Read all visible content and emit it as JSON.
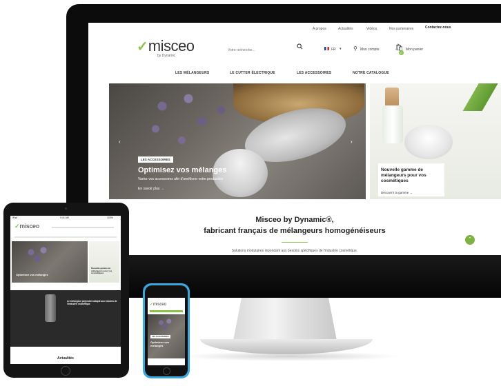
{
  "desktop": {
    "topbar": {
      "links": [
        "A propos",
        "Actualités",
        "Vidéos",
        "Nos partenaires"
      ],
      "contact": "Contactez-nous"
    },
    "header": {
      "logo_text": "misceo",
      "logo_sub": "by Dynamic",
      "search_placeholder": "Votre recherche...",
      "lang": "FR",
      "account": "Mon compte",
      "cart": "Mon panier",
      "cart_count": "0"
    },
    "nav": [
      "LES MÉLANGEURS",
      "LE CUTTER ÉLECTRIQUE",
      "LES ACCESSOIRES",
      "NOTRE CATALOGUE"
    ],
    "hero": {
      "tag": "LES ACCESSOIRES",
      "title": "Optimisez vos mélanges",
      "subtitle": "Variez vos accessoires afin d'améliorer votre production",
      "more": "En savoir plus  →"
    },
    "side": {
      "title": "Nouvelle gamme de mélangeurs pour vos cosmétiques",
      "link": "Découvrir la gamme  →"
    },
    "content": {
      "title": "Misceo by Dynamic®,",
      "subtitle": "fabricant français de mélangeurs homogénéiseurs",
      "desc": "Solutions modulaires répondant aux besoins spécifiques de l'industrie cosmétique."
    }
  },
  "tablet": {
    "status_left": "iPad",
    "status_time": "9:41 AM",
    "status_right": "100%",
    "logo_text": "misceo",
    "hero_title": "Optimisez vos mélanges",
    "side_title": "Nouvelle gamme de mélangeurs pour vos cosmétiques",
    "dark_title": "Le mélangeur polyvalent adapté aux besoins de l'industrie cosmétique",
    "news": "Actualités"
  },
  "phone": {
    "logo_text": "misceo",
    "hero_tag": "LES ACCESSOIRES",
    "hero_title": "Optimisez vos mélanges"
  },
  "colors": {
    "accent": "#8bc34a",
    "dark": "#0c0c0c",
    "phone_frame": "#35a9e0"
  }
}
